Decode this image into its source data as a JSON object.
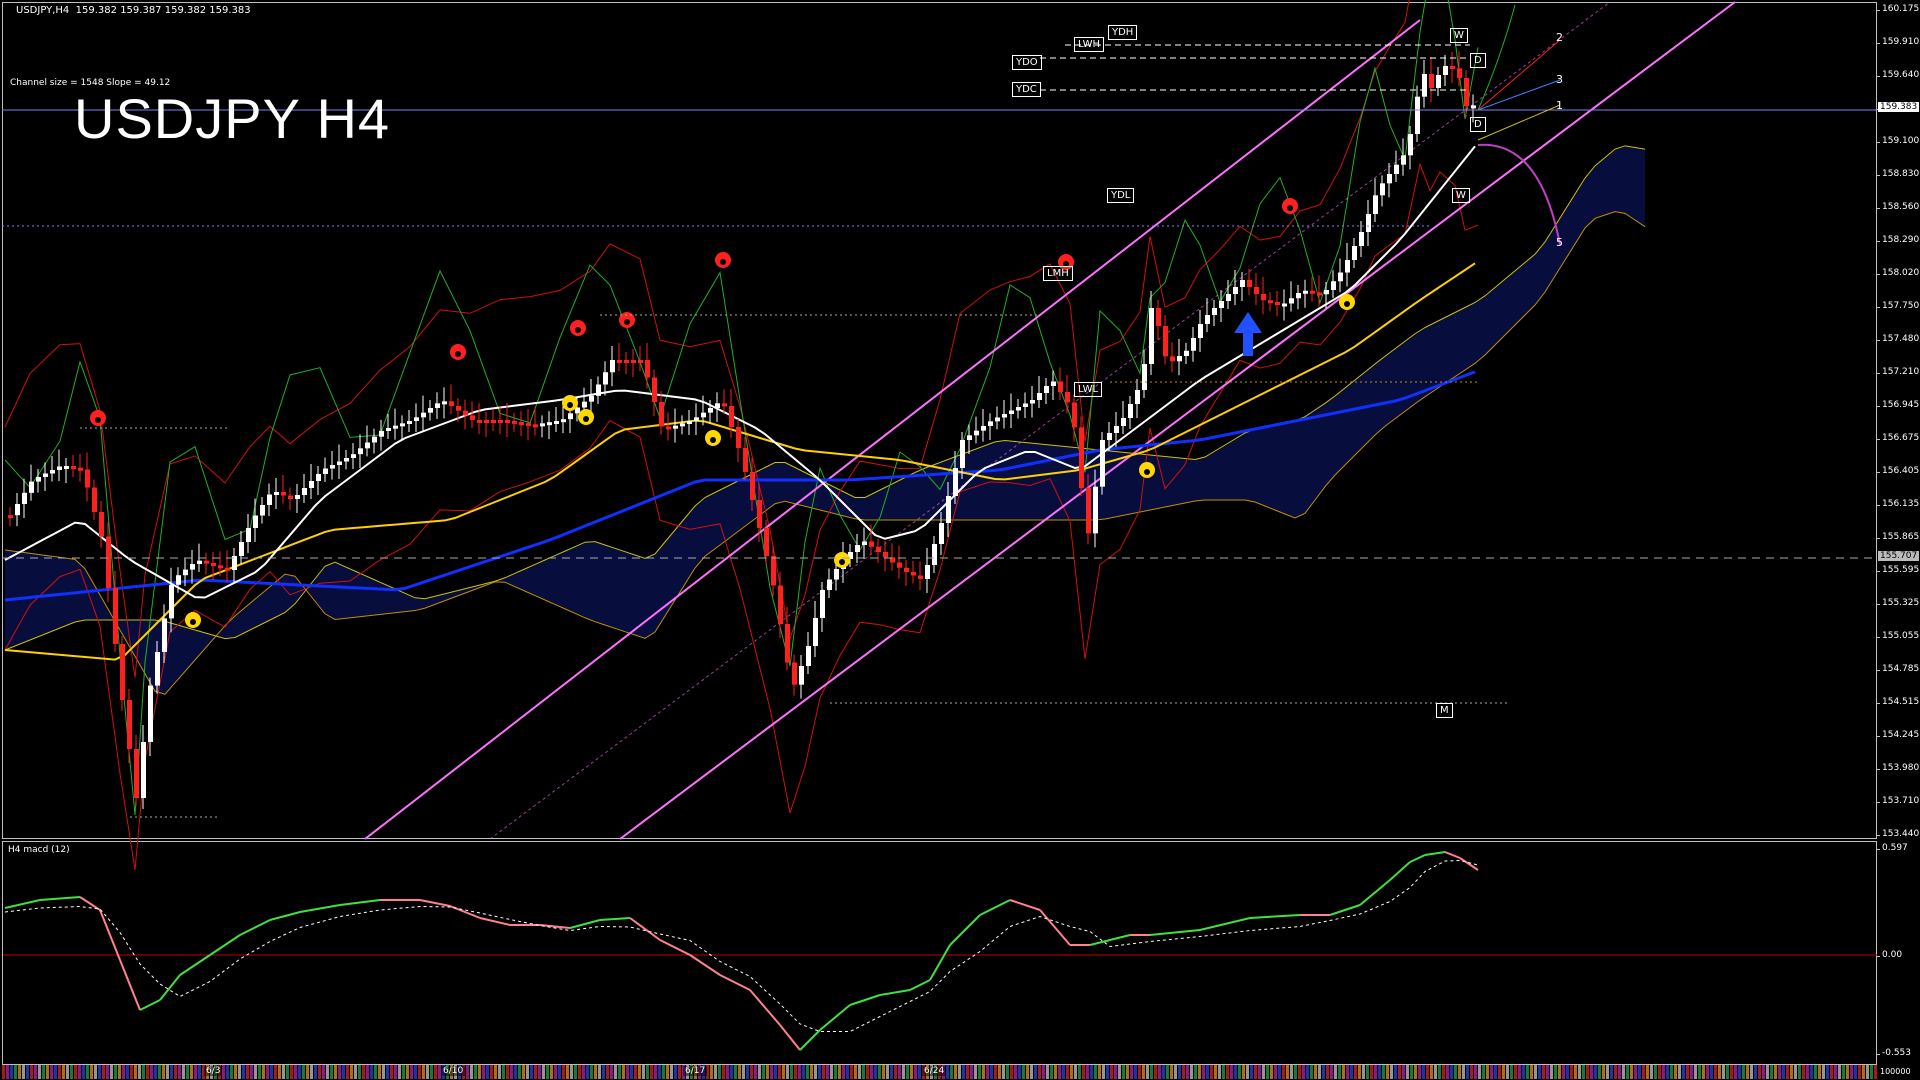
{
  "header": {
    "symbol_info": "USDJPY,H4",
    "quotes": "159.382 159.387 159.382 159.383",
    "channel_info": "Channel size = 1548 Slope = 49.12",
    "title": "USDJPY H4"
  },
  "price_axis": [
    "160.175",
    "159.910",
    "159.640",
    "159.370",
    "159.100",
    "158.830",
    "158.560",
    "158.290",
    "158.020",
    "157.750",
    "157.480",
    "157.210",
    "156.945",
    "156.675",
    "156.405",
    "156.135",
    "155.865",
    "155.595",
    "155.325",
    "155.055",
    "154.785",
    "154.515",
    "154.245",
    "153.980",
    "153.710",
    "153.440"
  ],
  "price_tags": {
    "current": "159.383",
    "dashed": "155.707"
  },
  "level_boxes": [
    {
      "label": "YDH",
      "color": "#e8c800"
    },
    {
      "label": "LWH",
      "color": "#e8a000"
    },
    {
      "label": "YDO",
      "color": "#ffffff"
    },
    {
      "label": "YDC",
      "color": "#ffffff"
    },
    {
      "label": "YDL",
      "color": "#e8c800"
    },
    {
      "label": "LMH",
      "color": "#ff2020"
    },
    {
      "label": "LWL",
      "color": "#e8a000"
    },
    {
      "label": "W",
      "color": "#e8c800"
    },
    {
      "label": "D",
      "color": "#e8c800"
    },
    {
      "label": "D",
      "color": "#e8c800"
    },
    {
      "label": "W",
      "color": "#ff3030"
    },
    {
      "label": "M",
      "color": "#ff2020"
    }
  ],
  "wave_labels": [
    "2",
    "3",
    "1",
    "5"
  ],
  "macd": {
    "title": "H4 macd (12)",
    "axis": [
      "0.597",
      "0.00",
      "-0.553"
    ]
  },
  "time_axis": {
    "dates": [
      "6/3",
      "6/10",
      "6/17",
      "6/24"
    ],
    "right_label": "100000"
  },
  "colors": {
    "background": "#000000",
    "bull": "#ffffff",
    "bear": "#ff2020",
    "channel": "#ff70ff",
    "ma_white": "#ffffff",
    "ma_yellow": "#ffd000",
    "ma_blue": "#1030ff",
    "macd_up": "#40e040",
    "macd_down": "#ff8090",
    "cloud": "#2040ff"
  }
}
